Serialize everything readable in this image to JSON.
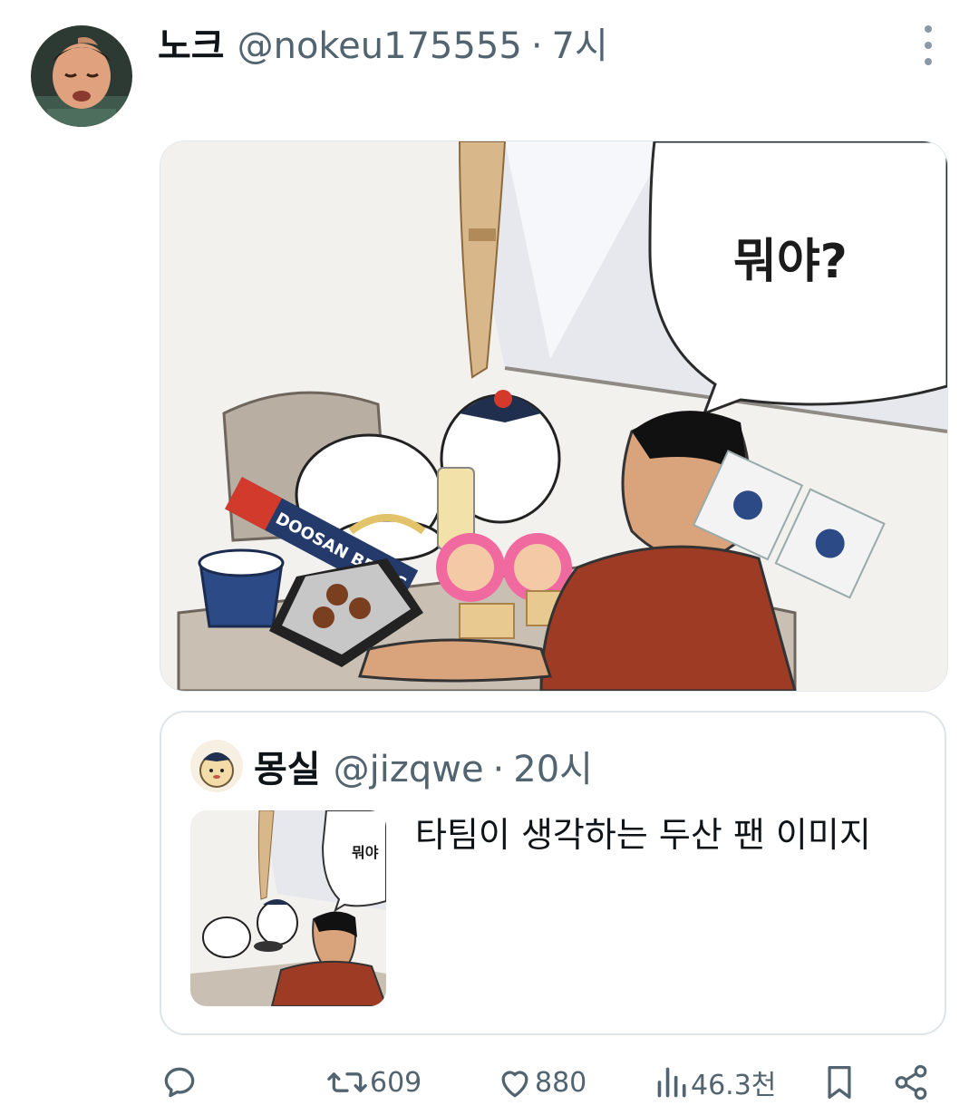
{
  "post": {
    "author_name": "노크",
    "author_handle": "@nokeu175555",
    "separator": "·",
    "time": "7시",
    "media": {
      "speech_bubble": "뭐야?",
      "package_text": "DOOSAN BEARS"
    }
  },
  "quoted_post": {
    "author_name": "몽실",
    "author_handle": "@jizqwe",
    "separator": "·",
    "time": "20시",
    "text": "타팀이 생각하는 두산 팬 이미지",
    "thumbnail_bubble": "뭐야"
  },
  "actions": {
    "reply_icon": "reply-icon",
    "repost_count": "609",
    "like_count": "880",
    "views_count": "46.3천",
    "bookmark_icon": "bookmark-icon",
    "share_icon": "share-icon"
  },
  "colors": {
    "text_primary": "#0f1419",
    "text_secondary": "#536471",
    "border": "#dfe4e8",
    "curtain": "#d8b88a",
    "shirt": "#9e3b24"
  }
}
